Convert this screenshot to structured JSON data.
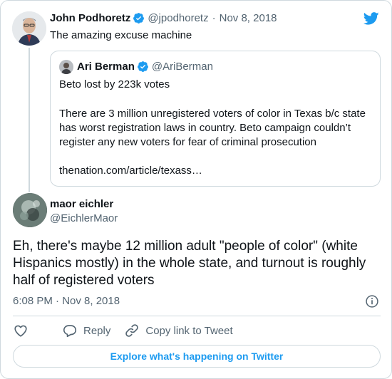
{
  "parent_tweet": {
    "author_name": "John Podhoretz",
    "handle": "@jpodhoretz",
    "separator": "·",
    "date": "Nov 8, 2018",
    "text": "The amazing excuse machine"
  },
  "quoted_tweet": {
    "author_name": "Ari Berman",
    "handle": "@AriBerman",
    "lines": [
      "Beto lost by 223k votes",
      "There are 3 million unregistered voters of color in Texas b/c state",
      "has worst registration laws in country. Beto campaign couldn’t",
      "register any new voters for fear of criminal prosecution",
      "thenation.com/article/texass…"
    ]
  },
  "main_tweet": {
    "author_name": "maor eichler",
    "handle": "@EichlerMaor",
    "text": "Eh, there's maybe 12 million adult \"people of color\" (white Hispanics mostly) in the whole state, and turnout is roughly half of registered voters",
    "timestamp": "6:08 PM · Nov 8, 2018"
  },
  "actions": {
    "reply_label": "Reply",
    "copy_link_label": "Copy link to Tweet"
  },
  "explore_label": "Explore what's happening on Twitter",
  "colors": {
    "accent": "#1d9bf0",
    "text": "#0f1419",
    "secondary": "#536471",
    "border": "#cfd9de"
  }
}
